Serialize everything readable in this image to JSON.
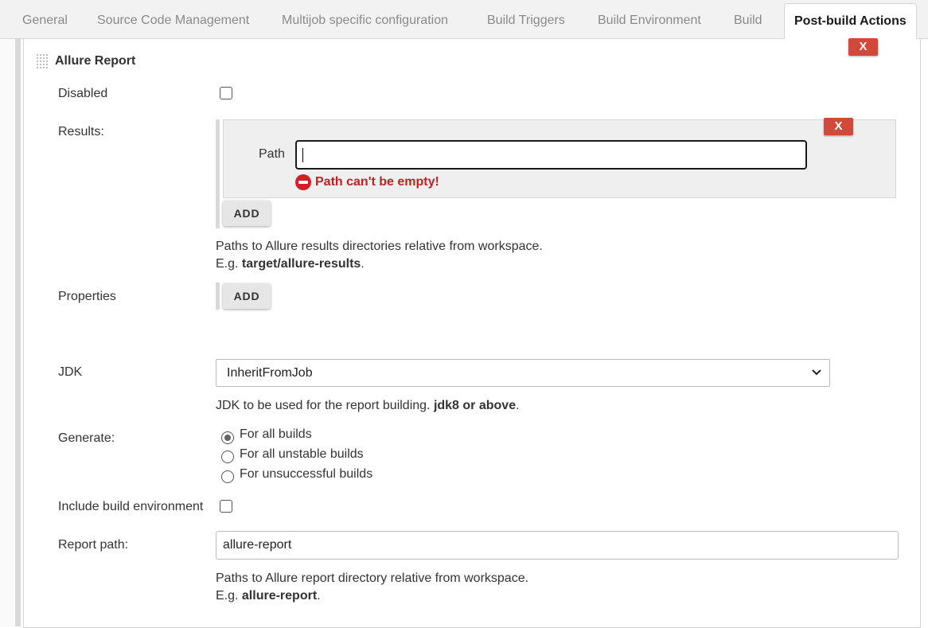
{
  "tabs": [
    {
      "label": "General"
    },
    {
      "label": "Source Code Management"
    },
    {
      "label": "Multijob specific configuration"
    },
    {
      "label": "Build Triggers"
    },
    {
      "label": "Build Environment"
    },
    {
      "label": "Build"
    },
    {
      "label": "Post-build Actions"
    }
  ],
  "section": {
    "title": "Allure Report",
    "delete_label": "X"
  },
  "form": {
    "disabled_label": "Disabled",
    "results_label": "Results:",
    "path_label": "Path",
    "path_value": "",
    "path_error": "Path can't be empty!",
    "result_delete_label": "X",
    "add_label": "ADD",
    "results_help_1": "Paths to Allure results directories relative from workspace.",
    "results_help_2_prefix": "E.g. ",
    "results_help_2_bold": "target/allure-results",
    "results_help_2_suffix": ".",
    "properties_label": "Properties",
    "properties_add_label": "ADD",
    "jdk_label": "JDK",
    "jdk_value": "InheritFromJob",
    "jdk_help_prefix": "JDK to be used for the report building. ",
    "jdk_help_bold": "jdk8 or above",
    "jdk_help_suffix": ".",
    "generate_label": "Generate:",
    "generate_options": [
      {
        "label": "For all builds",
        "selected": true
      },
      {
        "label": "For all unstable builds",
        "selected": false
      },
      {
        "label": "For unsuccessful builds",
        "selected": false
      }
    ],
    "include_env_label": "Include build environment",
    "report_path_label": "Report path:",
    "report_path_value": "allure-report",
    "report_help_1": "Paths to Allure report directory relative from workspace.",
    "report_help_2_prefix": "E.g. ",
    "report_help_2_bold": "allure-report",
    "report_help_2_suffix": "."
  },
  "colors": {
    "delete_button": "#d24939",
    "error_text": "#c41e23"
  }
}
